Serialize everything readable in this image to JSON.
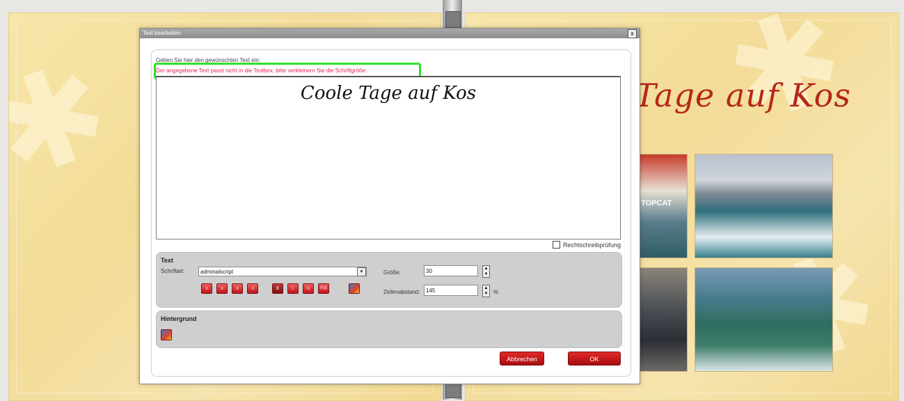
{
  "dialog": {
    "title": "Text bearbeiten",
    "close_label": "x",
    "instruction": "Geben Sie hier den gewünschten Text ein:",
    "warning": "Der angegebene Text passt nicht in die Textbox, bitte verkleinern Sie die Schriftgröße.",
    "text_content": "Coole Tage auf Kos",
    "spellcheck_label": "Rechtschreibprüfung",
    "text_panel": {
      "title": "Text",
      "font_label": "Schriftart:",
      "font_value": "adminalscript",
      "size_label": "Größe:",
      "size_value": "30",
      "line_spacing_label": "Zeilenabstand:",
      "line_spacing_value": "145",
      "line_spacing_unit": "%",
      "format_buttons": [
        "align-left",
        "align-center",
        "align-right",
        "justify",
        "bold",
        "italic",
        "underline",
        "fit",
        "font-color"
      ]
    },
    "background_panel": {
      "title": "Hintergrund"
    },
    "cancel_label": "Abbrechen",
    "ok_label": "OK"
  },
  "album": {
    "page_title": "Tage auf Kos",
    "photo_caption": "TOPCAT"
  },
  "colors": {
    "warning_highlight": "#2ee02e",
    "warning_text": "#e0245a",
    "accent_red": "#c0141a",
    "page_bg": "#f5e2a4"
  }
}
